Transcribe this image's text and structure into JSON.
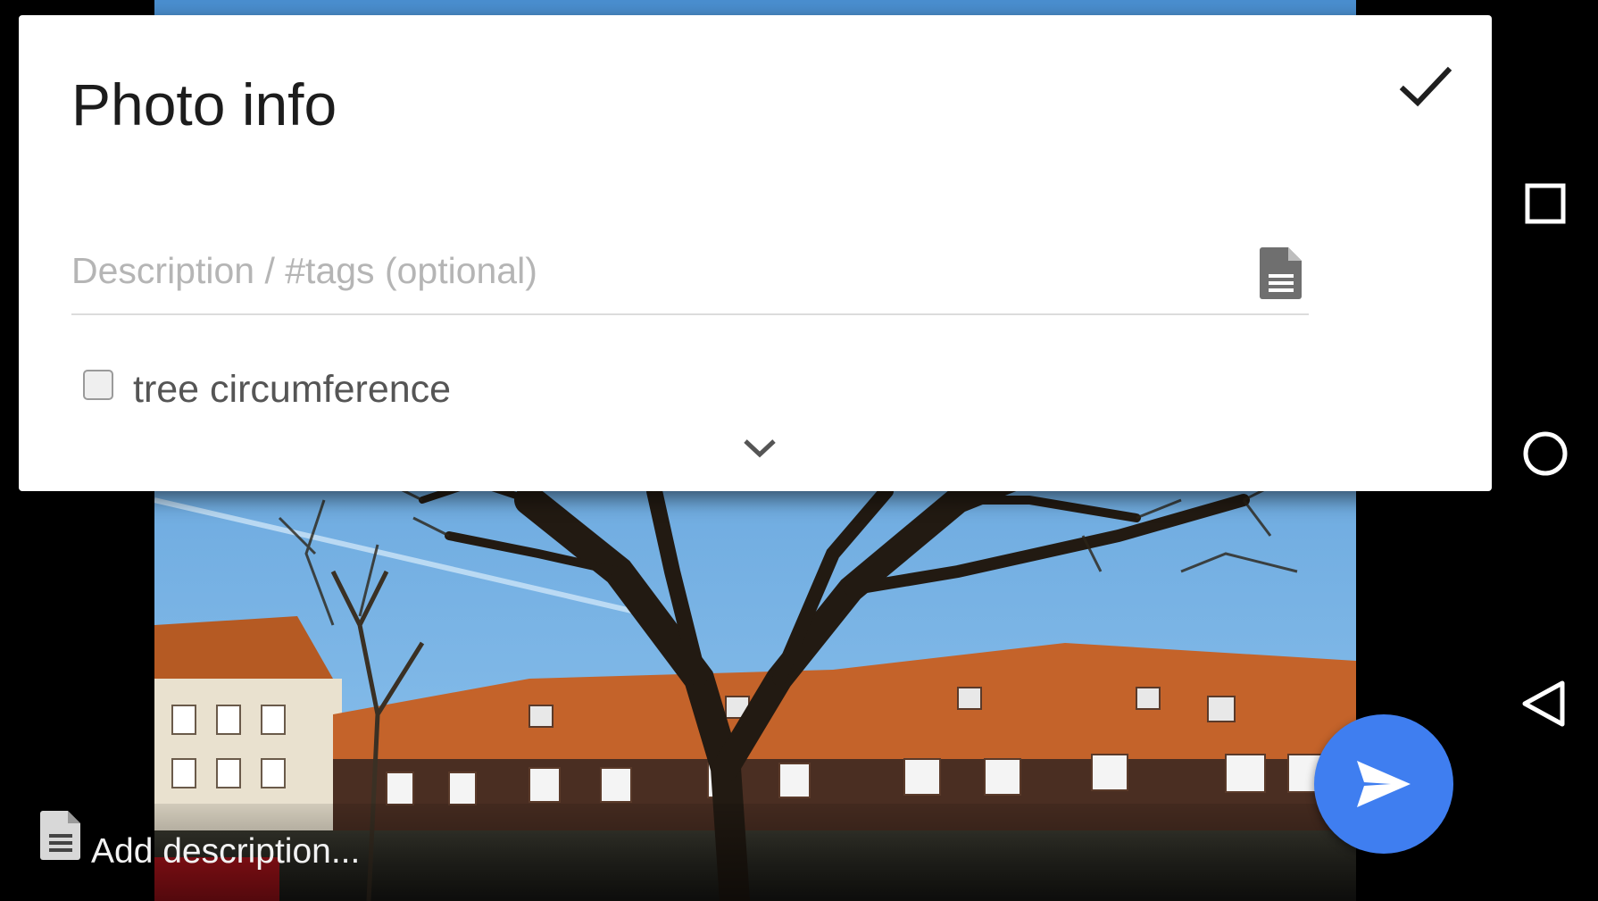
{
  "dialog": {
    "title": "Photo info",
    "confirm_icon": "check-icon",
    "description_placeholder": "Description / #tags (optional)",
    "description_value": "",
    "description_template_icon": "document-icon",
    "checkbox": {
      "label": "tree circumference",
      "checked": false
    },
    "expand_icon": "chevron-down-icon"
  },
  "bottom_bar": {
    "icon": "document-icon",
    "text": "Add description..."
  },
  "send_button": {
    "icon": "send-icon",
    "color": "#3f7ef0"
  },
  "nav_bar": {
    "items": [
      {
        "icon": "recents-square-icon"
      },
      {
        "icon": "home-circle-icon"
      },
      {
        "icon": "back-triangle-icon"
      }
    ]
  }
}
